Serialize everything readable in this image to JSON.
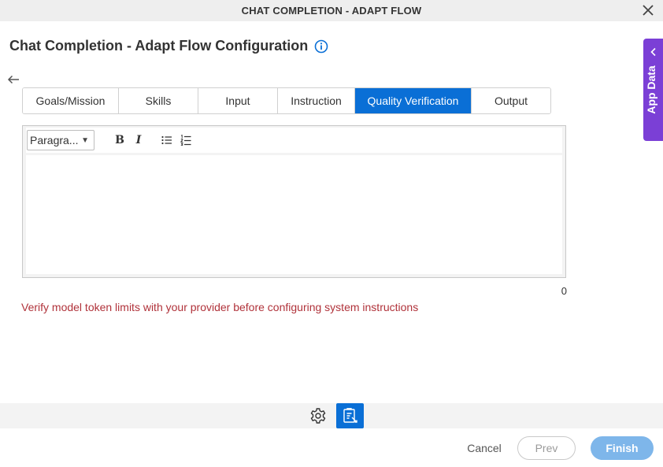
{
  "window": {
    "title": "CHAT COMPLETION - ADAPT FLOW",
    "close_icon": "close-icon"
  },
  "header": {
    "title": "Chat Completion - Adapt Flow Configuration",
    "info_icon": "info-icon"
  },
  "nav": {
    "back_icon": "arrow-left-icon"
  },
  "tabs": [
    {
      "label": "Goals/Mission",
      "active": false
    },
    {
      "label": "Skills",
      "active": false
    },
    {
      "label": "Input",
      "active": false
    },
    {
      "label": "Instruction",
      "active": false
    },
    {
      "label": "Quality Verification",
      "active": true
    },
    {
      "label": "Output",
      "active": false
    }
  ],
  "editor": {
    "format_value": "Paragra...",
    "bold_label": "B",
    "italic_label": "I",
    "content": "",
    "char_count": "0"
  },
  "warning": "Verify model token limits with your provider before configuring system instructions",
  "footer": {
    "cancel_label": "Cancel",
    "prev_label": "Prev",
    "finish_label": "Finish"
  },
  "side_panel": {
    "label": "App Data",
    "chevron_icon": "chevron-left-icon"
  },
  "colors": {
    "accent": "#0a6fd6",
    "side_panel": "#7b3fd6",
    "warning": "#b0323a",
    "finish_button": "#7eb6ea"
  }
}
